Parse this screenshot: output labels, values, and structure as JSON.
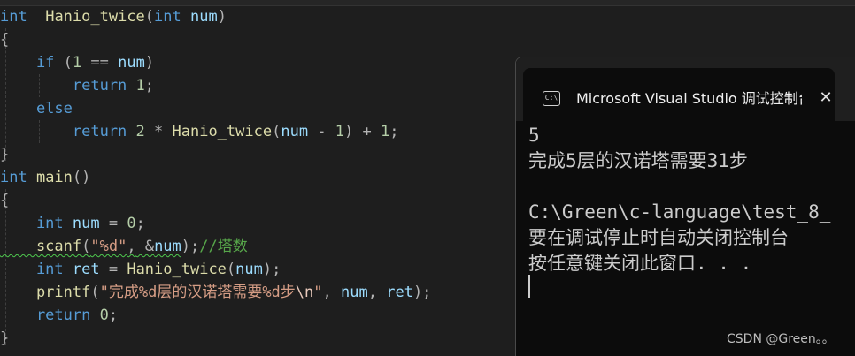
{
  "editor": {
    "lines": [
      {
        "tokens": [
          [
            "kw",
            "int"
          ],
          [
            "",
            "  "
          ],
          [
            "fn",
            "Hanio_twice"
          ],
          [
            "punc",
            "("
          ],
          [
            "kw",
            "int"
          ],
          [
            "",
            ""
          ],
          [
            "var",
            " num"
          ],
          [
            "punc",
            ")"
          ]
        ]
      },
      {
        "tokens": [
          [
            "punc",
            "{"
          ]
        ]
      },
      {
        "tokens": [
          [
            "",
            ""
          ],
          [
            "kw",
            "    if"
          ],
          [
            "punc",
            " ("
          ],
          [
            "num",
            "1"
          ],
          [
            "op",
            " =="
          ],
          [
            "var",
            " num"
          ],
          [
            "punc",
            ")"
          ]
        ]
      },
      {
        "tokens": [
          [
            "kw",
            "        return"
          ],
          [
            "num",
            " 1"
          ],
          [
            "punc",
            ";"
          ]
        ]
      },
      {
        "tokens": [
          [
            "kw",
            "    else"
          ]
        ]
      },
      {
        "tokens": [
          [
            "kw",
            "        return"
          ],
          [
            "num",
            " 2"
          ],
          [
            "op",
            " *"
          ],
          [
            "fn",
            " Hanio_twice"
          ],
          [
            "punc",
            "("
          ],
          [
            "var",
            "num"
          ],
          [
            "op",
            " -"
          ],
          [
            "num",
            " 1"
          ],
          [
            "punc",
            ")"
          ],
          [
            "op",
            " +"
          ],
          [
            "num",
            " 1"
          ],
          [
            "punc",
            ";"
          ]
        ]
      },
      {
        "tokens": [
          [
            "punc",
            "}"
          ]
        ]
      },
      {
        "tokens": [
          [
            "kw",
            "int"
          ],
          [
            "fn",
            " main"
          ],
          [
            "punc",
            "()"
          ]
        ]
      },
      {
        "tokens": [
          [
            "punc",
            "{"
          ]
        ]
      },
      {
        "tokens": [
          [
            "kw",
            "    int"
          ],
          [
            "var",
            " num"
          ],
          [
            "op",
            " ="
          ],
          [
            "num",
            " 0"
          ],
          [
            "punc",
            ";"
          ]
        ]
      },
      {
        "tokens": [
          [
            "fn squiggle",
            "    scanf"
          ],
          [
            "punc squiggle",
            "("
          ],
          [
            "str squiggle",
            "\"%d\""
          ],
          [
            "punc squiggle",
            ","
          ],
          [
            "op squiggle",
            " &"
          ],
          [
            "var squiggle",
            "num"
          ],
          [
            "punc",
            ");"
          ],
          [
            "cmt",
            "//塔数"
          ]
        ]
      },
      {
        "tokens": [
          [
            "kw",
            "    int"
          ],
          [
            "var",
            " ret"
          ],
          [
            "op",
            " ="
          ],
          [
            "fn",
            " Hanio_twice"
          ],
          [
            "punc",
            "("
          ],
          [
            "var",
            "num"
          ],
          [
            "punc",
            ");"
          ]
        ]
      },
      {
        "tokens": [
          [
            "fn",
            "    printf"
          ],
          [
            "punc",
            "("
          ],
          [
            "str",
            "\"完成%d层的汉诺塔需要%d步"
          ],
          [
            "esc",
            "\\n"
          ],
          [
            "str",
            "\""
          ],
          [
            "punc",
            ","
          ],
          [
            "var",
            " num"
          ],
          [
            "punc",
            ","
          ],
          [
            "var",
            " ret"
          ],
          [
            "punc",
            ");"
          ]
        ]
      },
      {
        "tokens": [
          [
            "kw",
            "    return"
          ],
          [
            "num",
            " 0"
          ],
          [
            "punc",
            ";"
          ]
        ]
      },
      {
        "tokens": [
          [
            "punc",
            "}"
          ]
        ]
      }
    ]
  },
  "console": {
    "title": "Microsoft Visual Studio 调试控制台",
    "icon_text": "C:\\",
    "close_glyph": "✕",
    "output": [
      "5",
      "完成5层的汉诺塔需要31步",
      "",
      "C:\\Green\\c-language\\test_8_",
      "要在调试停止时自动关闭控制台",
      "按任意键关闭此窗口. . ."
    ]
  },
  "watermark": "CSDN @Green。。",
  "icons": {
    "console_icon": "terminal-icon",
    "close": "close-icon"
  }
}
